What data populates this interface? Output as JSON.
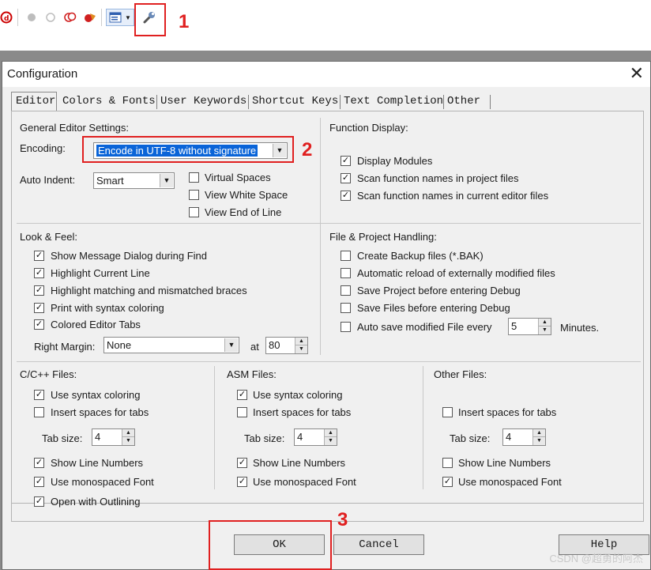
{
  "toolbar": {
    "annotation": "1"
  },
  "dialog": {
    "title": "Configuration",
    "close": "✕",
    "tabs": [
      "Editor",
      "Colors & Fonts",
      "User Keywords",
      "Shortcut Keys",
      "Text Completion",
      "Other"
    ],
    "general": {
      "heading": "General Editor Settings:",
      "encoding_label": "Encoding:",
      "encoding_value": "Encode in UTF-8 without signature",
      "annotation": "2",
      "auto_indent_label": "Auto Indent:",
      "auto_indent_value": "Smart",
      "options": [
        {
          "label": "Virtual Spaces",
          "checked": false
        },
        {
          "label": "View White Space",
          "checked": false
        },
        {
          "label": "View End of Line",
          "checked": false
        }
      ]
    },
    "function_display": {
      "heading": "Function Display:",
      "options": [
        {
          "label": "Display Modules",
          "checked": true
        },
        {
          "label": "Scan function names in project files",
          "checked": true
        },
        {
          "label": "Scan function names in current editor files",
          "checked": true
        }
      ]
    },
    "look_feel": {
      "heading": "Look & Feel:",
      "options": [
        {
          "label": "Show Message Dialog during Find",
          "checked": true
        },
        {
          "label": "Highlight Current Line",
          "checked": true
        },
        {
          "label": "Highlight matching and mismatched braces",
          "checked": true
        },
        {
          "label": "Print with syntax coloring",
          "checked": true
        },
        {
          "label": "Colored Editor Tabs",
          "checked": true
        }
      ],
      "right_margin_label": "Right Margin:",
      "right_margin_value": "None",
      "at_label": "at",
      "at_value": "80"
    },
    "file_project": {
      "heading": "File & Project Handling:",
      "options": [
        {
          "label": "Create Backup files (*.BAK)",
          "checked": false
        },
        {
          "label": "Automatic reload of externally modified files",
          "checked": false
        },
        {
          "label": "Save Project before entering Debug",
          "checked": false
        },
        {
          "label": "Save Files before entering Debug",
          "checked": false
        },
        {
          "label": "Auto save modified File every",
          "checked": false
        }
      ],
      "autosave_value": "5",
      "minutes_label": "Minutes."
    },
    "c_files": {
      "heading": "C/C++ Files:",
      "use_syntax": {
        "label": "Use syntax coloring",
        "checked": true
      },
      "insert_spaces": {
        "label": "Insert spaces for tabs",
        "checked": false
      },
      "tab_size_label": "Tab size:",
      "tab_size_value": "4",
      "show_line_numbers": {
        "label": "Show Line Numbers",
        "checked": true
      },
      "monospaced": {
        "label": "Use monospaced Font",
        "checked": true
      },
      "outlining": {
        "label": "Open with Outlining",
        "checked": true
      }
    },
    "asm_files": {
      "heading": "ASM Files:",
      "use_syntax": {
        "label": "Use syntax coloring",
        "checked": true
      },
      "insert_spaces": {
        "label": "Insert spaces for tabs",
        "checked": false
      },
      "tab_size_label": "Tab size:",
      "tab_size_value": "4",
      "show_line_numbers": {
        "label": "Show Line Numbers",
        "checked": true
      },
      "monospaced": {
        "label": "Use monospaced Font",
        "checked": true
      }
    },
    "other_files": {
      "heading": "Other Files:",
      "insert_spaces": {
        "label": "Insert spaces for tabs",
        "checked": false
      },
      "tab_size_label": "Tab size:",
      "tab_size_value": "4",
      "show_line_numbers": {
        "label": "Show Line Numbers",
        "checked": false
      },
      "monospaced": {
        "label": "Use monospaced Font",
        "checked": true
      }
    },
    "buttons": {
      "ok": "OK",
      "cancel": "Cancel",
      "help": "Help"
    },
    "ok_annotation": "3"
  },
  "watermark": "CSDN @超勇的阿杰",
  "colors": {
    "annotation": "#e02020",
    "selection": "#0a64d8"
  }
}
